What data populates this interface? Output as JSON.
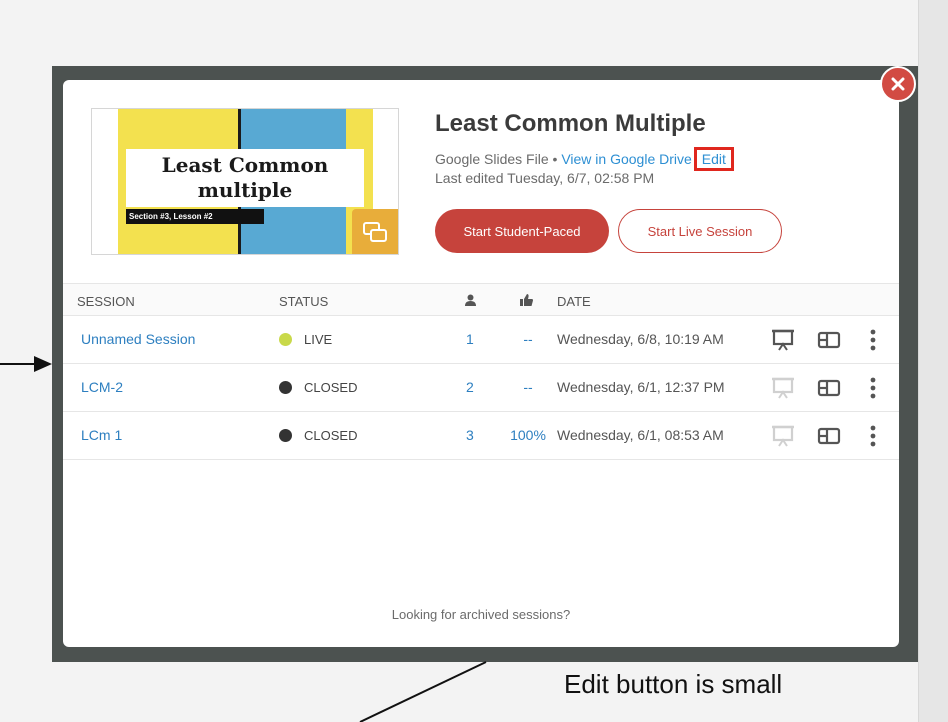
{
  "thumbnail": {
    "title": "Least Common multiple",
    "subtitle": "Section #3, Lesson #2",
    "colors": {
      "yellow": "#f3e14f",
      "blue": "#58a9d3",
      "icon_bg": "#e8ad3a"
    },
    "icon": "slides-icon"
  },
  "lesson": {
    "title": "Least Common Multiple",
    "file_type": "Google Slides File",
    "separator": " • ",
    "view_link": "View in Google Drive",
    "edit_link": "Edit",
    "last_edited": "Last edited Tuesday, 6/7, 02:58 PM"
  },
  "buttons": {
    "student_paced": "Start Student-Paced",
    "live_session": "Start Live Session"
  },
  "table": {
    "headers": {
      "session": "SESSION",
      "status": "STATUS",
      "students_icon": "person-icon",
      "likes_icon": "thumbs-up-icon",
      "date": "DATE"
    },
    "rows": [
      {
        "name": "Unnamed Session",
        "status": "LIVE",
        "status_color": "#c9d94a",
        "count": "1",
        "pct": "--",
        "date": "Wednesday, 6/8, 10:19 AM"
      },
      {
        "name": "LCM-2",
        "status": "CLOSED",
        "status_color": "#333333",
        "count": "2",
        "pct": "--",
        "date": "Wednesday, 6/1, 12:37 PM"
      },
      {
        "name": "LCm 1",
        "status": "CLOSED",
        "status_color": "#333333",
        "count": "3",
        "pct": "100%",
        "date": "Wednesday, 6/1, 08:53 AM"
      }
    ]
  },
  "footer": {
    "archived_link": "Looking for archived sessions?"
  },
  "annotation": {
    "text": "Edit button is small",
    "highlight_color": "#e0271e"
  },
  "colors": {
    "accent_red": "#c6433c",
    "link_blue": "#2d8fd3",
    "backdrop": "#4c5250"
  }
}
